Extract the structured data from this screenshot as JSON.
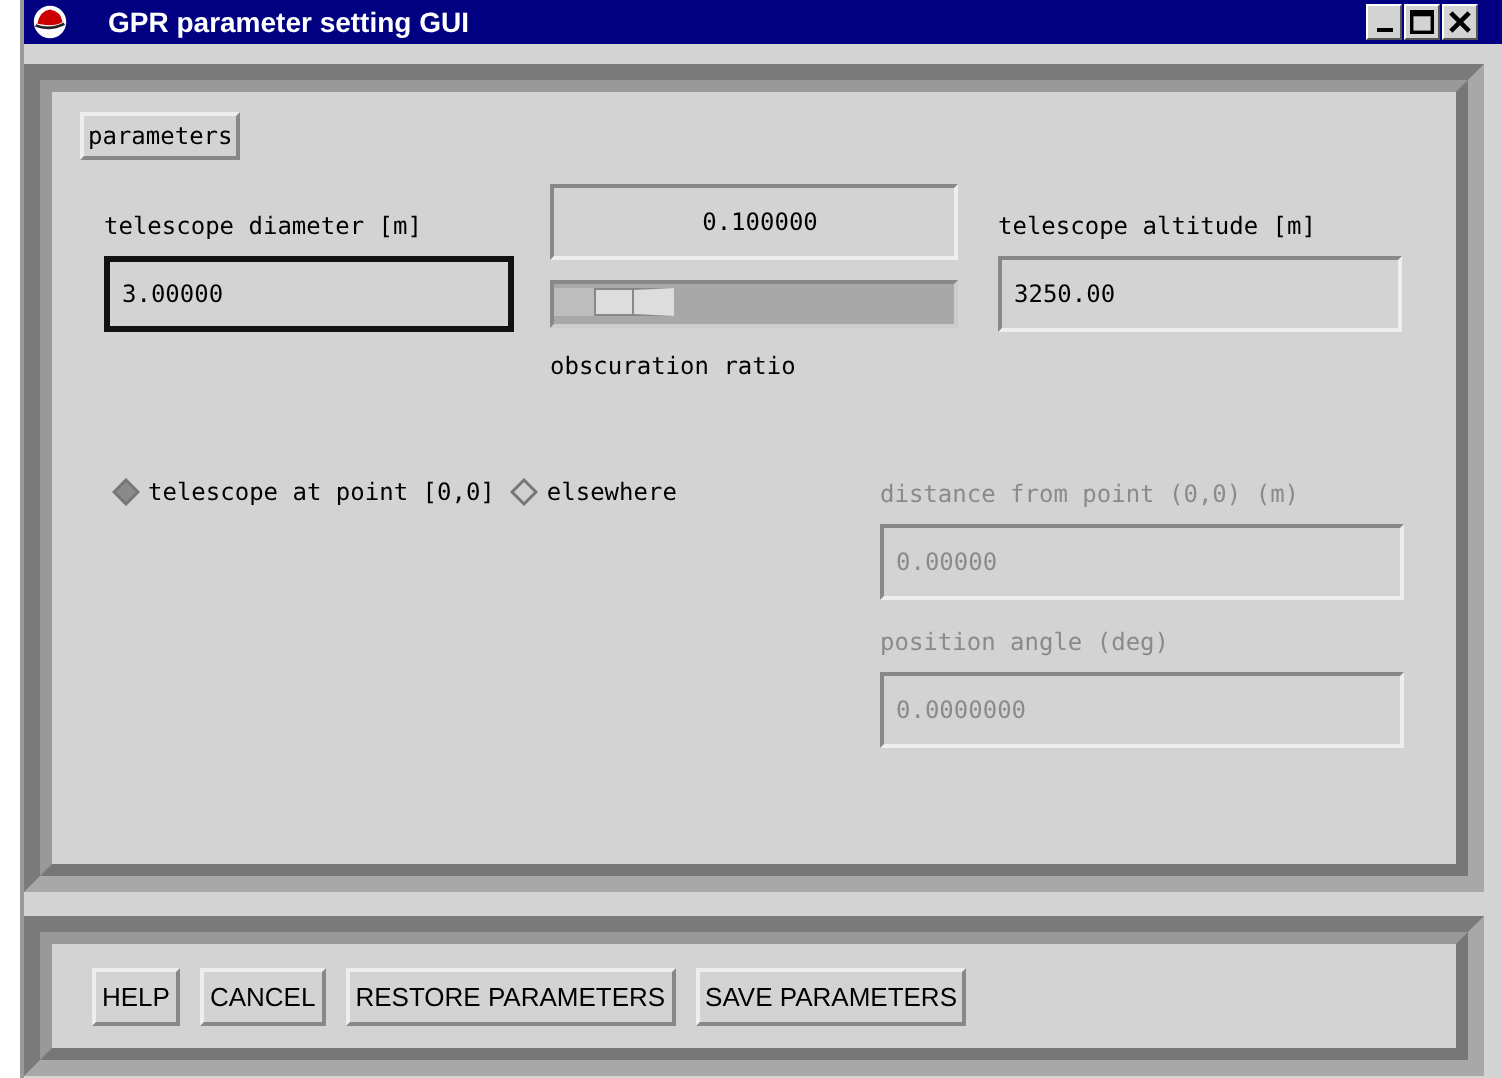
{
  "window": {
    "title": "GPR parameter setting GUI"
  },
  "menu_button": "parameters",
  "diameter": {
    "label": "telescope diameter [m]",
    "value": "3.00000",
    "focused": true
  },
  "obscuration": {
    "value": "0.100000",
    "level": 0.1,
    "label": "obscuration ratio"
  },
  "altitude": {
    "label": "telescope altitude [m]",
    "value": "3250.00",
    "focused": false
  },
  "location_options": [
    {
      "label": "telescope at point [0,0]",
      "selected": true
    },
    {
      "label": "elsewhere",
      "selected": false
    }
  ],
  "offset_fields": [
    {
      "label": "distance from point (0,0) (m)",
      "value": "0.00000",
      "disabled": true
    },
    {
      "label": "position angle (deg)",
      "value": "0.0000000",
      "disabled": true
    }
  ],
  "buttons": [
    "HELP",
    "CANCEL",
    "RESTORE PARAMETERS",
    "SAVE PARAMETERS"
  ]
}
